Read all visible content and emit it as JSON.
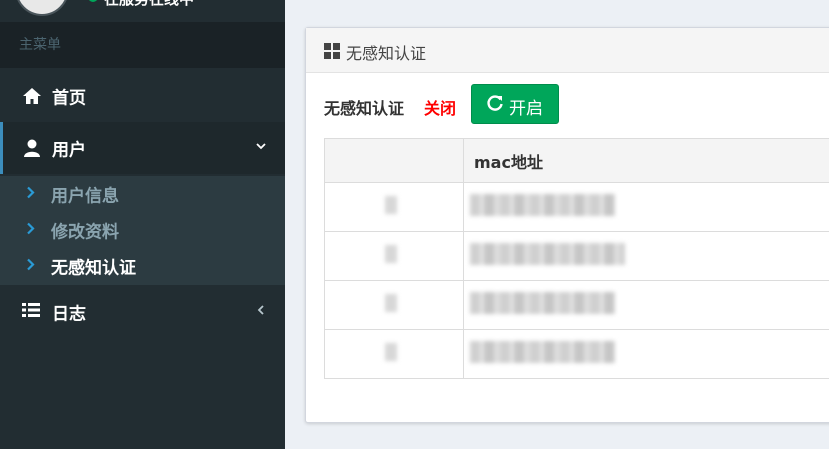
{
  "sidebar": {
    "user_panel": {
      "status_text": "在服务在线中"
    },
    "menu_header": "主菜单",
    "items": {
      "home": {
        "label": "首页",
        "icon": "home-icon"
      },
      "user": {
        "label": "用户",
        "icon": "user-icon",
        "expanded": true
      },
      "log": {
        "label": "日志",
        "icon": "list-icon"
      }
    },
    "submenu": [
      {
        "label": "用户信息",
        "active": false
      },
      {
        "label": "修改资料",
        "active": false
      },
      {
        "label": "无感知认证",
        "active": true
      }
    ]
  },
  "main": {
    "box_title": "无感知认证",
    "status_label": "无感知认证",
    "status_value": "关闭",
    "enable_button": "开启",
    "table": {
      "headers": [
        "",
        "mac地址"
      ],
      "rows": [
        {
          "col1": "",
          "mac": ""
        },
        {
          "col1": "",
          "mac": ""
        },
        {
          "col1": "",
          "mac": ""
        },
        {
          "col1": "",
          "mac": ""
        }
      ]
    }
  },
  "colors": {
    "sidebar_bg": "#222d32",
    "accent_blue": "#3c8dbc",
    "button_green": "#00a65a",
    "status_red": "#ff0000"
  }
}
